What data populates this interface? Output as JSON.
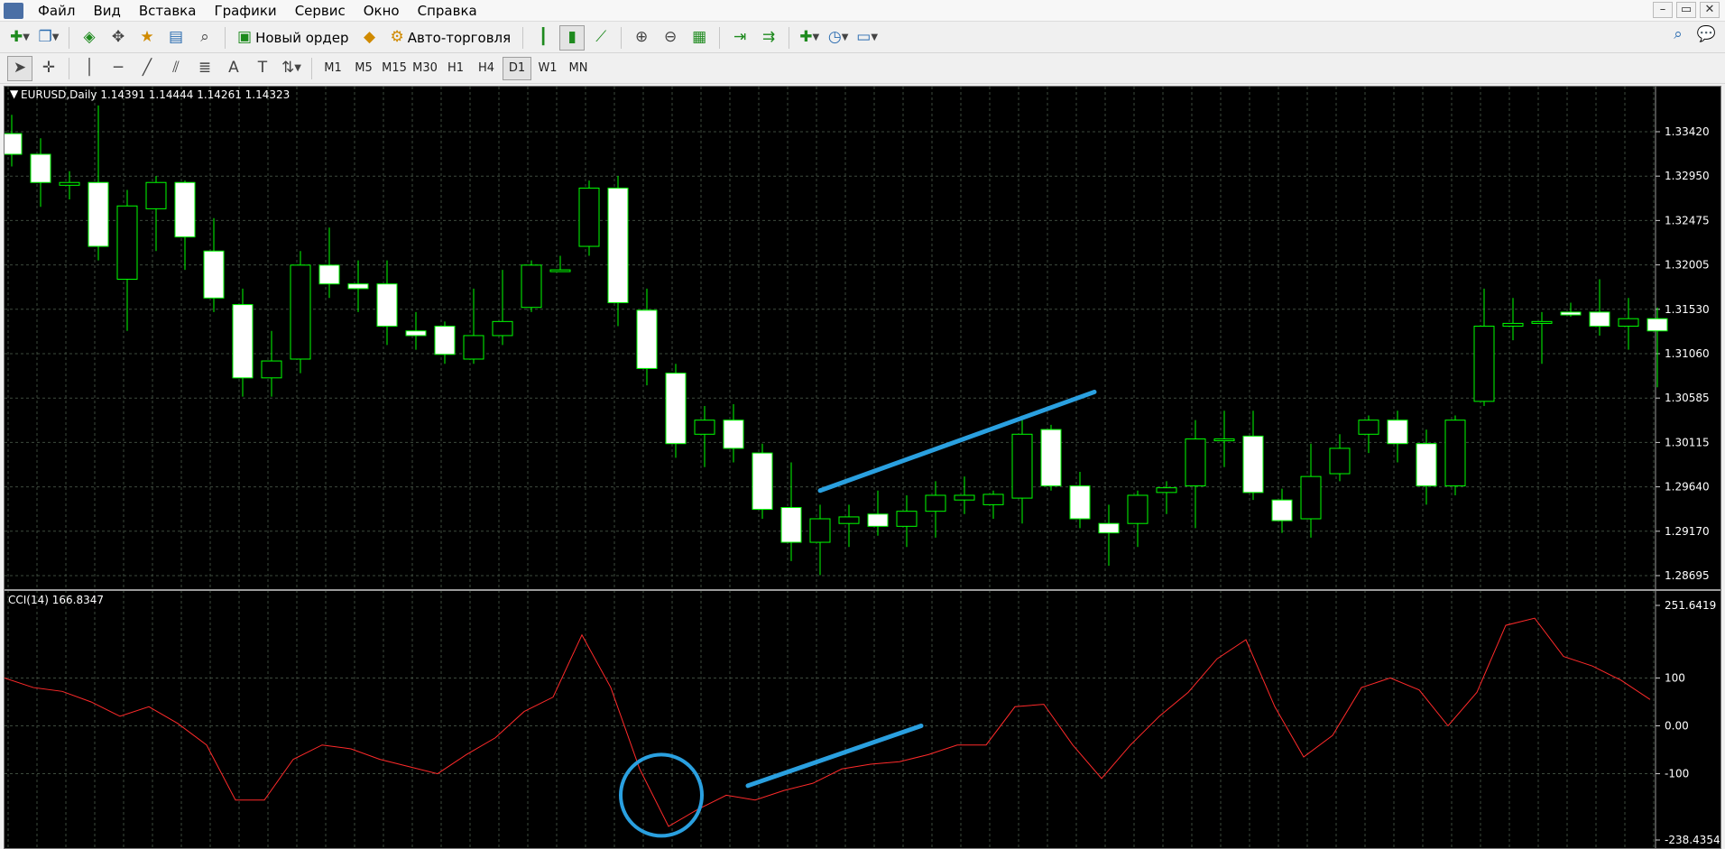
{
  "menu": {
    "items": [
      "Файл",
      "Вид",
      "Вставка",
      "Графики",
      "Сервис",
      "Окно",
      "Справка"
    ]
  },
  "window_controls": {
    "minimize": "–",
    "restore": "▭",
    "close": "✕"
  },
  "toolbar": {
    "new_order_label": "Новый ордер",
    "auto_trading_label": "Авто-торговля"
  },
  "timeframes": [
    "M1",
    "M5",
    "M15",
    "M30",
    "H1",
    "H4",
    "D1",
    "W1",
    "MN"
  ],
  "active_timeframe": "D1",
  "icons": {
    "new_chart": "plus-icon",
    "profiles": "windows-icon",
    "market_watch": "market-icon",
    "navigator": "crosshair-icon",
    "favorites": "star-icon",
    "terminal": "terminal-icon",
    "tester": "tester-icon",
    "zoom_in": "zoom-in-icon",
    "zoom_out": "zoom-out-icon",
    "tile": "tile-icon",
    "bars": "bar-chart-icon",
    "candles": "candle-chart-icon",
    "line": "line-chart-icon",
    "indicators": "indicator-icon",
    "periods": "clock-icon",
    "templates": "template-icon",
    "search": "search-icon",
    "chat": "chat-icon"
  },
  "colors": {
    "background": "#000000",
    "grid": "#3d4a3d",
    "bull_candle_fill": "#000000",
    "bear_candle_fill": "#ffffff",
    "candle_outline": "#00ff00",
    "cci_line": "#ff2a2a",
    "annotation": "#2aa0e0"
  },
  "chart_data": {
    "type": "candlestick",
    "symbol_header": "EURUSD,Daily  1.14391 1.14444 1.14261 1.14323",
    "price_axis_labels": [
      "1.33420",
      "1.32950",
      "1.32475",
      "1.32005",
      "1.31530",
      "1.31060",
      "1.30585",
      "1.30115",
      "1.29640",
      "1.29170",
      "1.28695"
    ],
    "price_range": [
      1.2845,
      1.3375
    ],
    "candles": [
      {
        "o": 1.334,
        "h": 1.336,
        "l": 1.3305,
        "c": 1.3318
      },
      {
        "o": 1.3318,
        "h": 1.3335,
        "l": 1.3262,
        "c": 1.3288
      },
      {
        "o": 1.3285,
        "h": 1.33,
        "l": 1.327,
        "c": 1.3288
      },
      {
        "o": 1.3288,
        "h": 1.337,
        "l": 1.3205,
        "c": 1.322
      },
      {
        "o": 1.3185,
        "h": 1.328,
        "l": 1.313,
        "c": 1.3263
      },
      {
        "o": 1.326,
        "h": 1.3295,
        "l": 1.3215,
        "c": 1.3288
      },
      {
        "o": 1.3288,
        "h": 1.329,
        "l": 1.3195,
        "c": 1.323
      },
      {
        "o": 1.3215,
        "h": 1.325,
        "l": 1.315,
        "c": 1.3165
      },
      {
        "o": 1.3158,
        "h": 1.3175,
        "l": 1.306,
        "c": 1.308
      },
      {
        "o": 1.308,
        "h": 1.313,
        "l": 1.306,
        "c": 1.3098
      },
      {
        "o": 1.31,
        "h": 1.3215,
        "l": 1.3085,
        "c": 1.32
      },
      {
        "o": 1.32,
        "h": 1.324,
        "l": 1.3165,
        "c": 1.318
      },
      {
        "o": 1.318,
        "h": 1.3205,
        "l": 1.315,
        "c": 1.3175
      },
      {
        "o": 1.318,
        "h": 1.3205,
        "l": 1.3115,
        "c": 1.3135
      },
      {
        "o": 1.313,
        "h": 1.315,
        "l": 1.311,
        "c": 1.3125
      },
      {
        "o": 1.3135,
        "h": 1.314,
        "l": 1.3095,
        "c": 1.3105
      },
      {
        "o": 1.31,
        "h": 1.3175,
        "l": 1.3095,
        "c": 1.3125
      },
      {
        "o": 1.3125,
        "h": 1.3195,
        "l": 1.3115,
        "c": 1.314
      },
      {
        "o": 1.3155,
        "h": 1.3205,
        "l": 1.315,
        "c": 1.32
      },
      {
        "o": 1.3195,
        "h": 1.321,
        "l": 1.3195,
        "c": 1.3195
      },
      {
        "o": 1.322,
        "h": 1.329,
        "l": 1.321,
        "c": 1.3282
      },
      {
        "o": 1.3282,
        "h": 1.3295,
        "l": 1.3135,
        "c": 1.316
      },
      {
        "o": 1.3152,
        "h": 1.3175,
        "l": 1.3072,
        "c": 1.309
      },
      {
        "o": 1.3085,
        "h": 1.3095,
        "l": 1.2995,
        "c": 1.301
      },
      {
        "o": 1.302,
        "h": 1.305,
        "l": 1.2985,
        "c": 1.3035
      },
      {
        "o": 1.3035,
        "h": 1.3052,
        "l": 1.299,
        "c": 1.3005
      },
      {
        "o": 1.3,
        "h": 1.301,
        "l": 1.293,
        "c": 1.294
      },
      {
        "o": 1.2942,
        "h": 1.299,
        "l": 1.2885,
        "c": 1.2905
      },
      {
        "o": 1.2905,
        "h": 1.2945,
        "l": 1.287,
        "c": 1.293
      },
      {
        "o": 1.2925,
        "h": 1.2945,
        "l": 1.29,
        "c": 1.2932
      },
      {
        "o": 1.2935,
        "h": 1.296,
        "l": 1.2912,
        "c": 1.2922
      },
      {
        "o": 1.2922,
        "h": 1.2955,
        "l": 1.29,
        "c": 1.2938
      },
      {
        "o": 1.2938,
        "h": 1.297,
        "l": 1.291,
        "c": 1.2955
      },
      {
        "o": 1.295,
        "h": 1.2975,
        "l": 1.2935,
        "c": 1.2955
      },
      {
        "o": 1.2945,
        "h": 1.296,
        "l": 1.293,
        "c": 1.2956
      },
      {
        "o": 1.2952,
        "h": 1.304,
        "l": 1.2925,
        "c": 1.302
      },
      {
        "o": 1.3025,
        "h": 1.303,
        "l": 1.296,
        "c": 1.2965
      },
      {
        "o": 1.2965,
        "h": 1.298,
        "l": 1.292,
        "c": 1.293
      },
      {
        "o": 1.2925,
        "h": 1.2945,
        "l": 1.288,
        "c": 1.2915
      },
      {
        "o": 1.2925,
        "h": 1.296,
        "l": 1.29,
        "c": 1.2955
      },
      {
        "o": 1.2958,
        "h": 1.297,
        "l": 1.2935,
        "c": 1.2963
      },
      {
        "o": 1.2965,
        "h": 1.3035,
        "l": 1.292,
        "c": 1.3015
      },
      {
        "o": 1.3015,
        "h": 1.3045,
        "l": 1.2985,
        "c": 1.3015
      },
      {
        "o": 1.3018,
        "h": 1.3045,
        "l": 1.295,
        "c": 1.2958
      },
      {
        "o": 1.295,
        "h": 1.2962,
        "l": 1.2915,
        "c": 1.2928
      },
      {
        "o": 1.293,
        "h": 1.301,
        "l": 1.291,
        "c": 1.2975
      },
      {
        "o": 1.2978,
        "h": 1.302,
        "l": 1.297,
        "c": 1.3005
      },
      {
        "o": 1.302,
        "h": 1.304,
        "l": 1.3,
        "c": 1.3035
      },
      {
        "o": 1.3035,
        "h": 1.3045,
        "l": 1.299,
        "c": 1.301
      },
      {
        "o": 1.301,
        "h": 1.3025,
        "l": 1.2945,
        "c": 1.2965
      },
      {
        "o": 1.2965,
        "h": 1.304,
        "l": 1.2955,
        "c": 1.3035
      },
      {
        "o": 1.3055,
        "h": 1.3175,
        "l": 1.305,
        "c": 1.3135
      },
      {
        "o": 1.3135,
        "h": 1.3165,
        "l": 1.312,
        "c": 1.3138
      },
      {
        "o": 1.3138,
        "h": 1.315,
        "l": 1.3095,
        "c": 1.314
      },
      {
        "o": 1.315,
        "h": 1.316,
        "l": 1.3145,
        "c": 1.3147
      },
      {
        "o": 1.315,
        "h": 1.3185,
        "l": 1.3125,
        "c": 1.3135
      },
      {
        "o": 1.3135,
        "h": 1.3165,
        "l": 1.311,
        "c": 1.3143
      },
      {
        "o": 1.3143,
        "h": 1.3155,
        "l": 1.307,
        "c": 1.313
      }
    ],
    "indicator": {
      "header": "CCI(14) 166.8347",
      "axis_labels": [
        "251.6419",
        "100",
        "0.00",
        "-100",
        "-238.4354"
      ],
      "range": [
        -238.4354,
        251.6419
      ],
      "values": [
        100,
        80,
        72,
        50,
        20,
        40,
        5,
        -40,
        -155,
        -155,
        -70,
        -40,
        -48,
        -70,
        -85,
        -100,
        -60,
        -25,
        30,
        60,
        190,
        80,
        -90,
        -210,
        -175,
        -145,
        -155,
        -135,
        -120,
        -90,
        -80,
        -75,
        -60,
        -40,
        -40,
        40,
        45,
        -40,
        -110,
        -40,
        20,
        70,
        140,
        180,
        40,
        -65,
        -20,
        80,
        100,
        75,
        0,
        70,
        210,
        225,
        145,
        125,
        95,
        55
      ]
    },
    "annotations": [
      {
        "pane": "price",
        "type": "trendline",
        "from": {
          "candle": 28,
          "value": 1.296
        },
        "to": {
          "candle": 37.5,
          "value": 1.3065
        }
      },
      {
        "pane": "indicator",
        "type": "trendline",
        "from": {
          "candle": 25.5,
          "value": -125
        },
        "to": {
          "candle": 31.5,
          "value": 0
        }
      },
      {
        "pane": "indicator",
        "type": "circle",
        "center": {
          "candle": 22.5,
          "value": -145
        }
      }
    ]
  }
}
